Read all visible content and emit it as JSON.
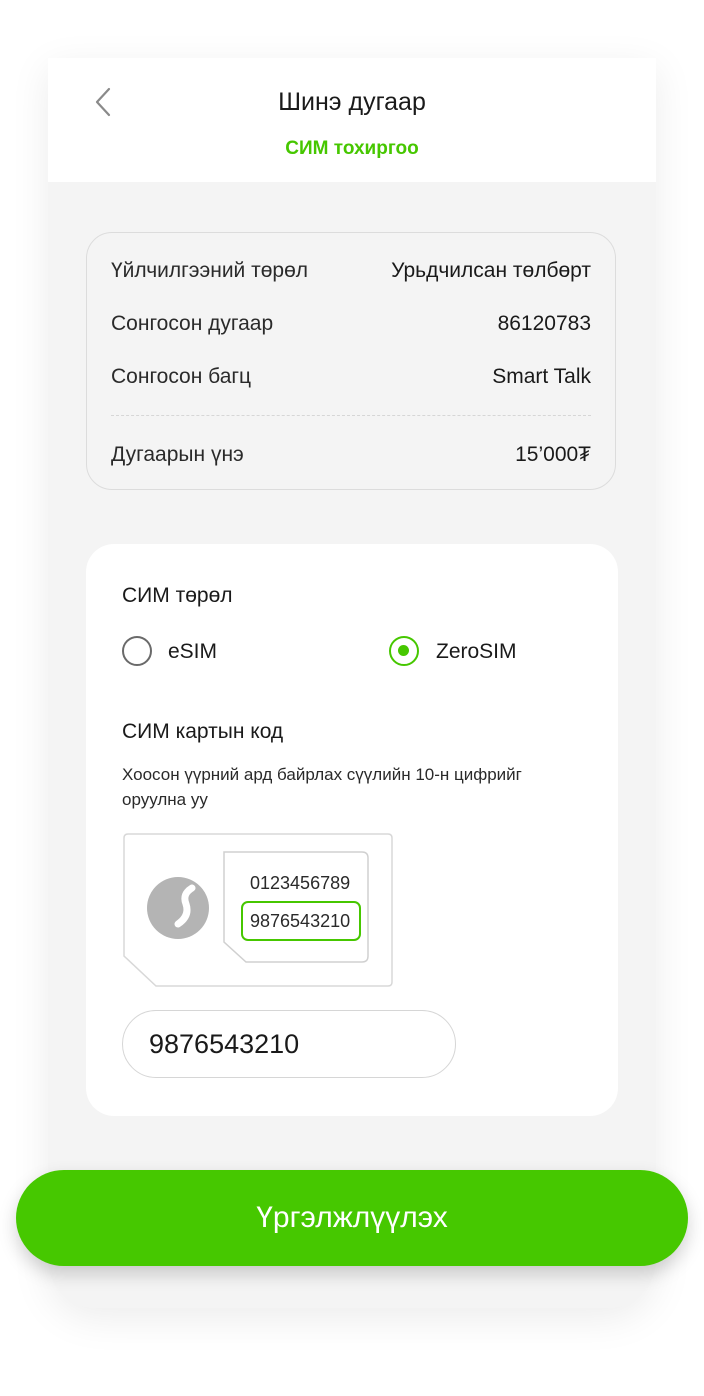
{
  "header": {
    "title": "Шинэ дугаар",
    "subtitle": "СИМ тохиргоо"
  },
  "summary": {
    "rows": [
      {
        "label": "Үйлчилгээний төрөл",
        "value": "Урьдчилсан төлбөрт"
      },
      {
        "label": "Сонгосон дугаар",
        "value": "86120783"
      },
      {
        "label": "Сонгосон багц",
        "value": "Smart Talk"
      }
    ],
    "total": {
      "label": "Дугаарын үнэ",
      "value": "15’000₮"
    }
  },
  "sim_type": {
    "label": "СИМ төрөл",
    "options": [
      {
        "label": "eSIM",
        "selected": false
      },
      {
        "label": "ZeroSIM",
        "selected": true
      }
    ]
  },
  "sim_code": {
    "label": "СИМ картын код",
    "hint": "Хоосон үүрний ард байрлах сүүлийн 10-н цифрийг оруулна уу",
    "illustration": {
      "line1": "0123456789",
      "line2": "9876543210"
    },
    "input_value": "9876543210"
  },
  "cta": {
    "label": "Үргэлжлүүлэх"
  },
  "colors": {
    "accent": "#46c800",
    "background": "#f4f4f4"
  }
}
